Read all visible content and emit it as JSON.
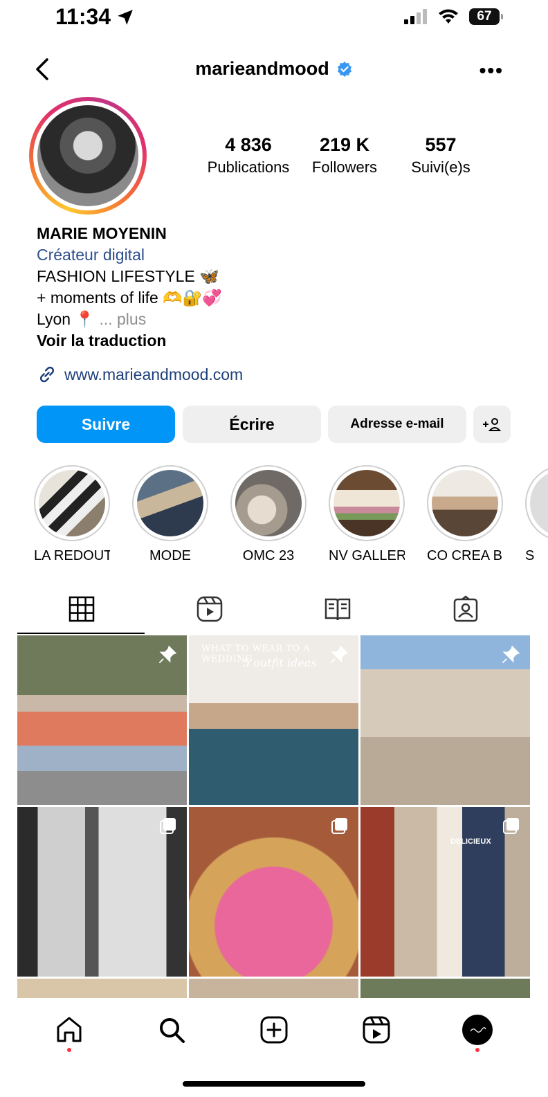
{
  "status_bar": {
    "time": "11:34",
    "battery": "67"
  },
  "header": {
    "username": "marieandmood"
  },
  "stats": [
    {
      "value": "4 836",
      "label": "Publications"
    },
    {
      "value": "219 K",
      "label": "Followers"
    },
    {
      "value": "557",
      "label": "Suivi(e)s"
    }
  ],
  "bio": {
    "name": "MARIE MOYENIN",
    "category": "Créateur digital",
    "line1": "FASHION LIFESTYLE 🦋",
    "line2": "+ moments of life 🫶🔐💞",
    "line3": "Lyon 📍",
    "more": "... plus",
    "translate": "Voir la traduction",
    "link": "www.marieandmood.com"
  },
  "buttons": {
    "follow": "Suivre",
    "message": "Écrire",
    "email": "Adresse e-mail",
    "add_user": "+&"
  },
  "highlights": [
    {
      "label": "LA REDOUT..."
    },
    {
      "label": "MODE"
    },
    {
      "label": "OMC 23"
    },
    {
      "label": "NV GALLERY"
    },
    {
      "label": "CO CREA BI..."
    },
    {
      "label": "S"
    }
  ],
  "posts": {
    "post2_text": "WHAT TO WEAR TO A WEDDING",
    "post2_script": "5 outfit ideas",
    "post6_sign": "DELICIEUX"
  },
  "colors": {
    "accent": "#0095f6",
    "link": "#1d3f7a",
    "notification": "#ff3040"
  }
}
